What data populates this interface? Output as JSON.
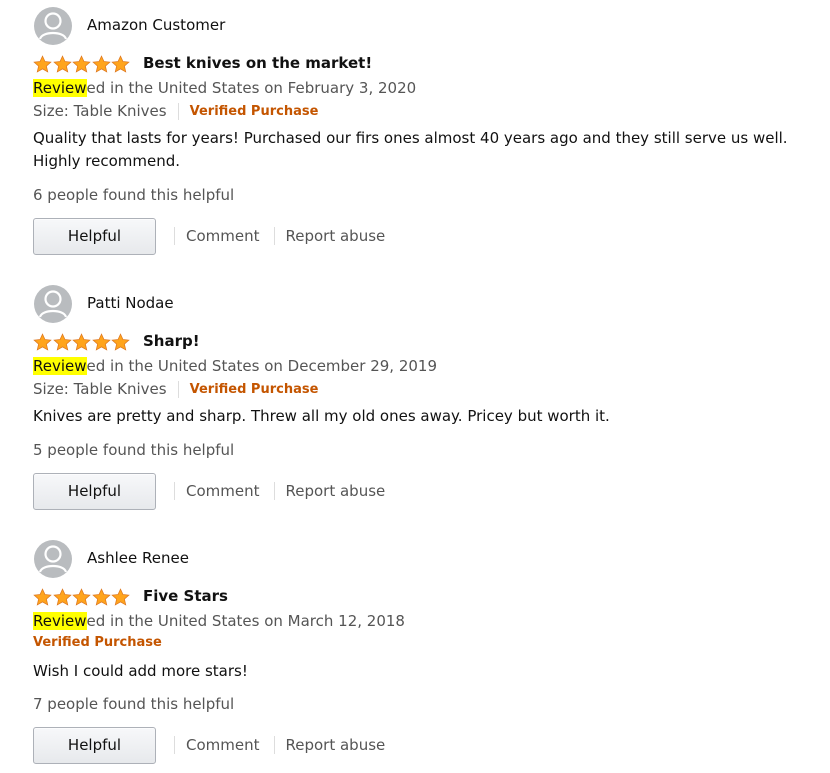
{
  "colors": {
    "star": "#ffa41c",
    "verified": "#c45500",
    "highlight": "#ffff00",
    "secondary_text": "#555555"
  },
  "actions": {
    "helpful_label": "Helpful",
    "comment_label": "Comment",
    "report_label": "Report abuse"
  },
  "reviews": [
    {
      "author": "Amazon Customer",
      "rating": 5,
      "title": "Best knives on the market!",
      "date_highlight": "Review",
      "date_rest": "ed in the United States on February 3, 2020",
      "size": "Size: Table Knives",
      "verified": "Verified Purchase",
      "body": "Quality that lasts for years! Purchased our firs ones almost 40 years ago and they still serve us well. Highly recommend.",
      "helpful_count": "6 people found this helpful"
    },
    {
      "author": "Patti Nodae",
      "rating": 5,
      "title": "Sharp!",
      "date_highlight": "Review",
      "date_rest": "ed in the United States on December 29, 2019",
      "size": "Size: Table Knives",
      "verified": "Verified Purchase",
      "body": "Knives are pretty and sharp. Threw all my old ones away. Pricey but worth it.",
      "helpful_count": "5 people found this helpful"
    },
    {
      "author": "Ashlee Renee",
      "rating": 5,
      "title": "Five Stars",
      "date_highlight": "Review",
      "date_rest": "ed in the United States on March 12, 2018",
      "verified": "Verified Purchase",
      "body": "Wish I could add more stars!",
      "helpful_count": "7 people found this helpful"
    }
  ]
}
